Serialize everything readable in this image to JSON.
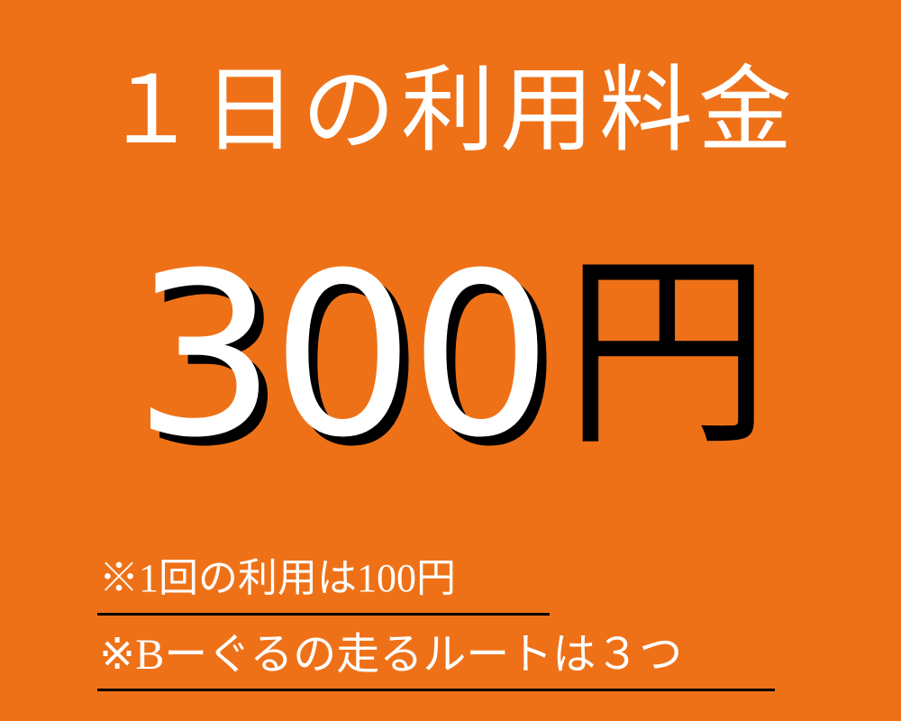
{
  "title": "１日の利用料金",
  "price": {
    "amount": "300",
    "unit": "円"
  },
  "notes": [
    "※1回の利用は100円",
    "※Bーぐるの走るルートは３つ"
  ],
  "colors": {
    "background": "#EE7118",
    "text": "#FFFFFF",
    "shadow": "#000000",
    "underline": "#000000"
  }
}
